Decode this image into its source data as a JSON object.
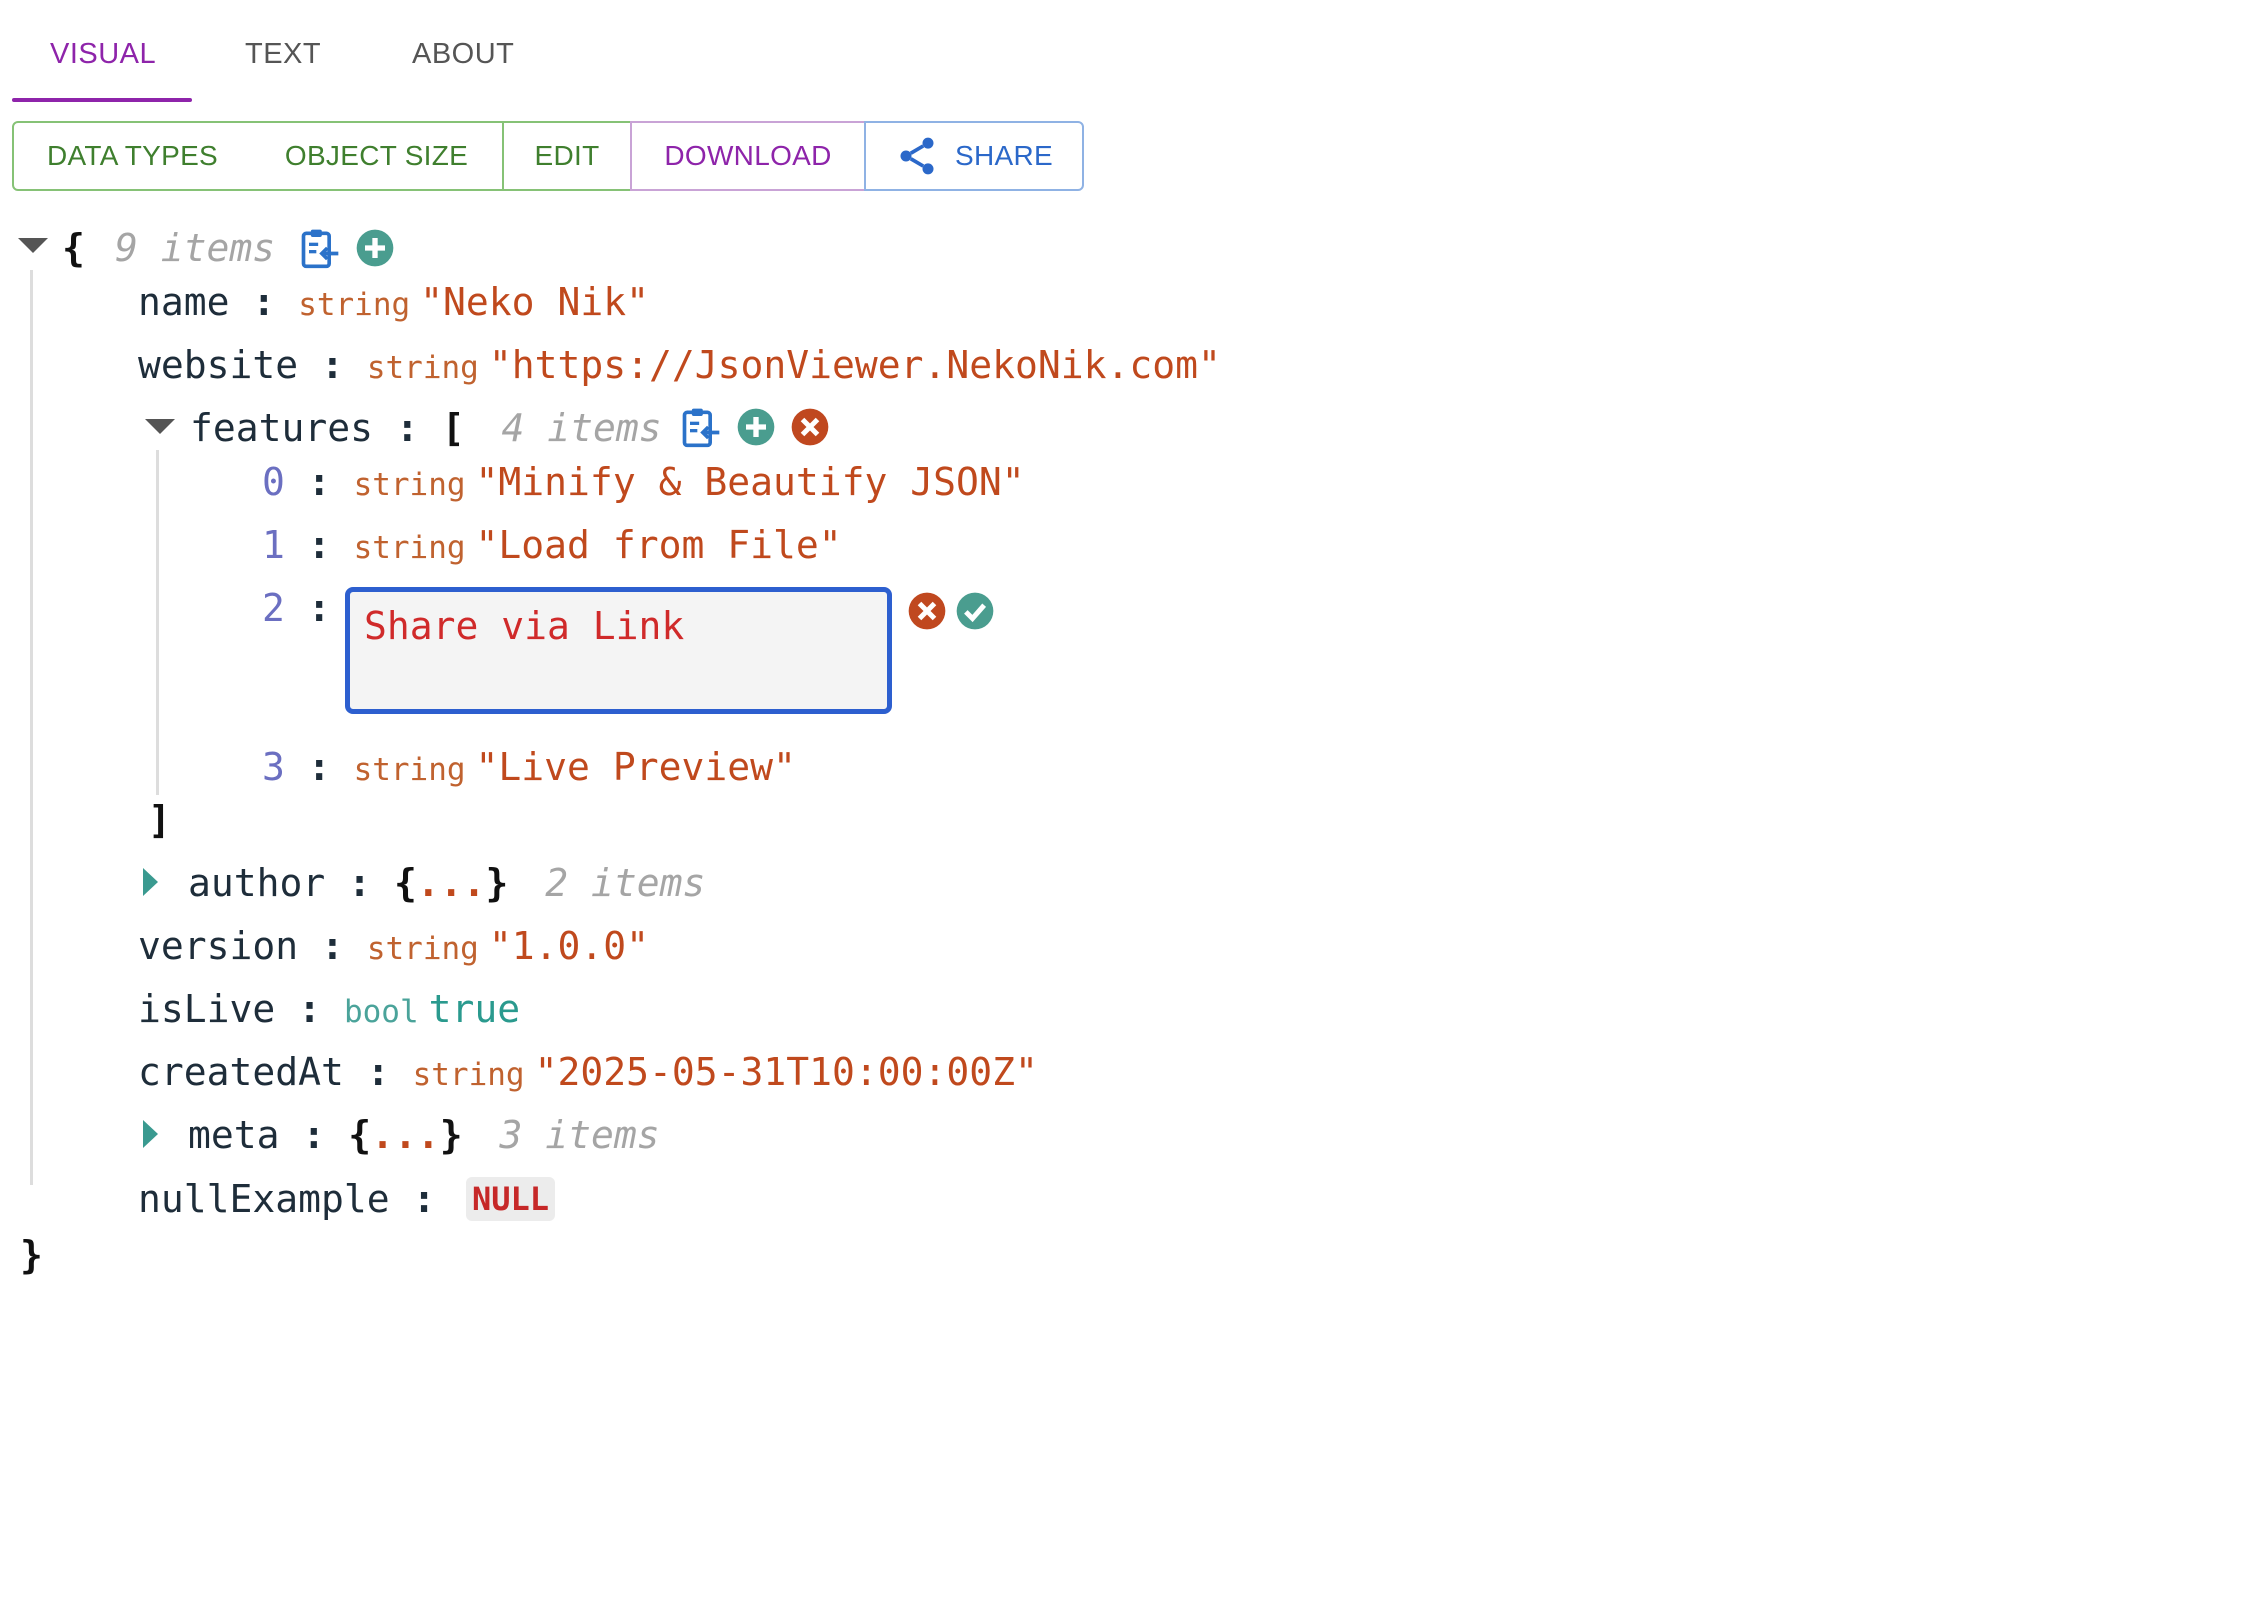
{
  "tabs": [
    {
      "label": "VISUAL",
      "active": true
    },
    {
      "label": "TEXT",
      "active": false
    },
    {
      "label": "ABOUT",
      "active": false
    }
  ],
  "toolbar": {
    "data_types": "DATA TYPES",
    "object_size": "OBJECT SIZE",
    "edit": "EDIT",
    "download": "DOWNLOAD",
    "share": "SHARE"
  },
  "colors": {
    "accent": "#8e24aa",
    "string_value": "#c0491d",
    "bool_value": "#2a9a8e",
    "add_icon": "#4a9d8f",
    "remove_icon": "#c0481f",
    "edit_border": "#2d5fcf"
  },
  "tree": {
    "root_open": "{",
    "root_count": "9 items",
    "root_close": "}",
    "colon": ":",
    "name": {
      "key": "name",
      "type": "string",
      "value": "\"Neko Nik\""
    },
    "website": {
      "key": "website",
      "type": "string",
      "value": "\"https://JsonViewer.NekoNik.com\""
    },
    "features": {
      "key": "features",
      "open": "[",
      "count": "4 items",
      "close": "]",
      "items": [
        {
          "index": "0",
          "type": "string",
          "value": "\"Minify & Beautify JSON\""
        },
        {
          "index": "1",
          "type": "string",
          "value": "\"Load from File\""
        },
        {
          "index": "2",
          "editing_value": "Share via Link"
        },
        {
          "index": "3",
          "type": "string",
          "value": "\"Live Preview\""
        }
      ]
    },
    "author": {
      "key": "author",
      "open": "{",
      "dots": "...",
      "close": "}",
      "count": "2 items"
    },
    "version": {
      "key": "version",
      "type": "string",
      "value": "\"1.0.0\""
    },
    "isLive": {
      "key": "isLive",
      "type": "bool",
      "value": "true"
    },
    "createdAt": {
      "key": "createdAt",
      "type": "string",
      "value": "\"2025-05-31T10:00:00Z\""
    },
    "meta": {
      "key": "meta",
      "open": "{",
      "dots": "...",
      "close": "}",
      "count": "3 items"
    },
    "nullExample": {
      "key": "nullExample",
      "value": "NULL"
    }
  },
  "icons": {
    "copy": "clipboard-copy-icon",
    "add": "plus-circle-icon",
    "remove": "close-circle-icon",
    "confirm": "check-circle-icon",
    "share": "share-icon",
    "expand": "caret-right-icon",
    "collapse": "caret-down-icon"
  }
}
